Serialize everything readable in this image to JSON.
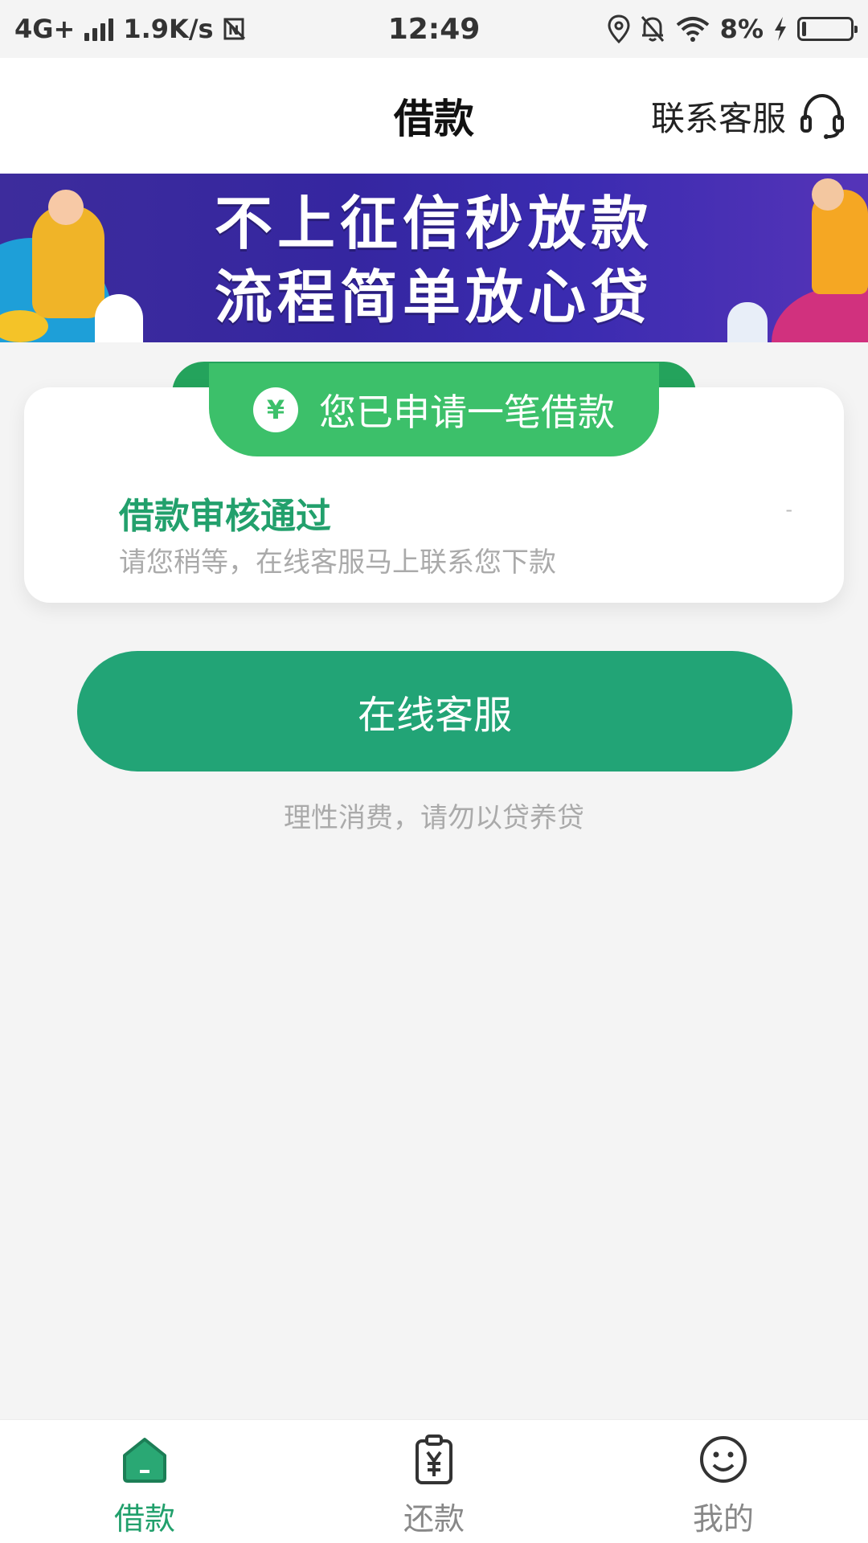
{
  "status_bar": {
    "network": "4G+",
    "speed": "1.9K/s",
    "time": "12:49",
    "battery": "8%",
    "battery_level": 0.08
  },
  "header": {
    "title": "借款",
    "service_label": "联系客服"
  },
  "banner": {
    "line1": "不上征信秒放款",
    "line2": "流程简单放心贷"
  },
  "status_card": {
    "pill_text": "您已申请一笔借款",
    "pill_icon_glyph": "¥",
    "title": "借款审核通过",
    "subtitle": "请您稍等，在线客服马上联系您下款",
    "dash": "-"
  },
  "actions": {
    "service_button": "在线客服",
    "tip": "理性消费，请勿以贷养贷"
  },
  "tab_bar": {
    "items": [
      {
        "label": "借款",
        "icon": "home-icon",
        "active": true
      },
      {
        "label": "还款",
        "icon": "repay-clipboard-icon",
        "active": false
      },
      {
        "label": "我的",
        "icon": "smiley-icon",
        "active": false
      }
    ]
  },
  "colors": {
    "accent": "#22a476",
    "pill": "#3cc06a",
    "inactive_tab": "#888888"
  }
}
